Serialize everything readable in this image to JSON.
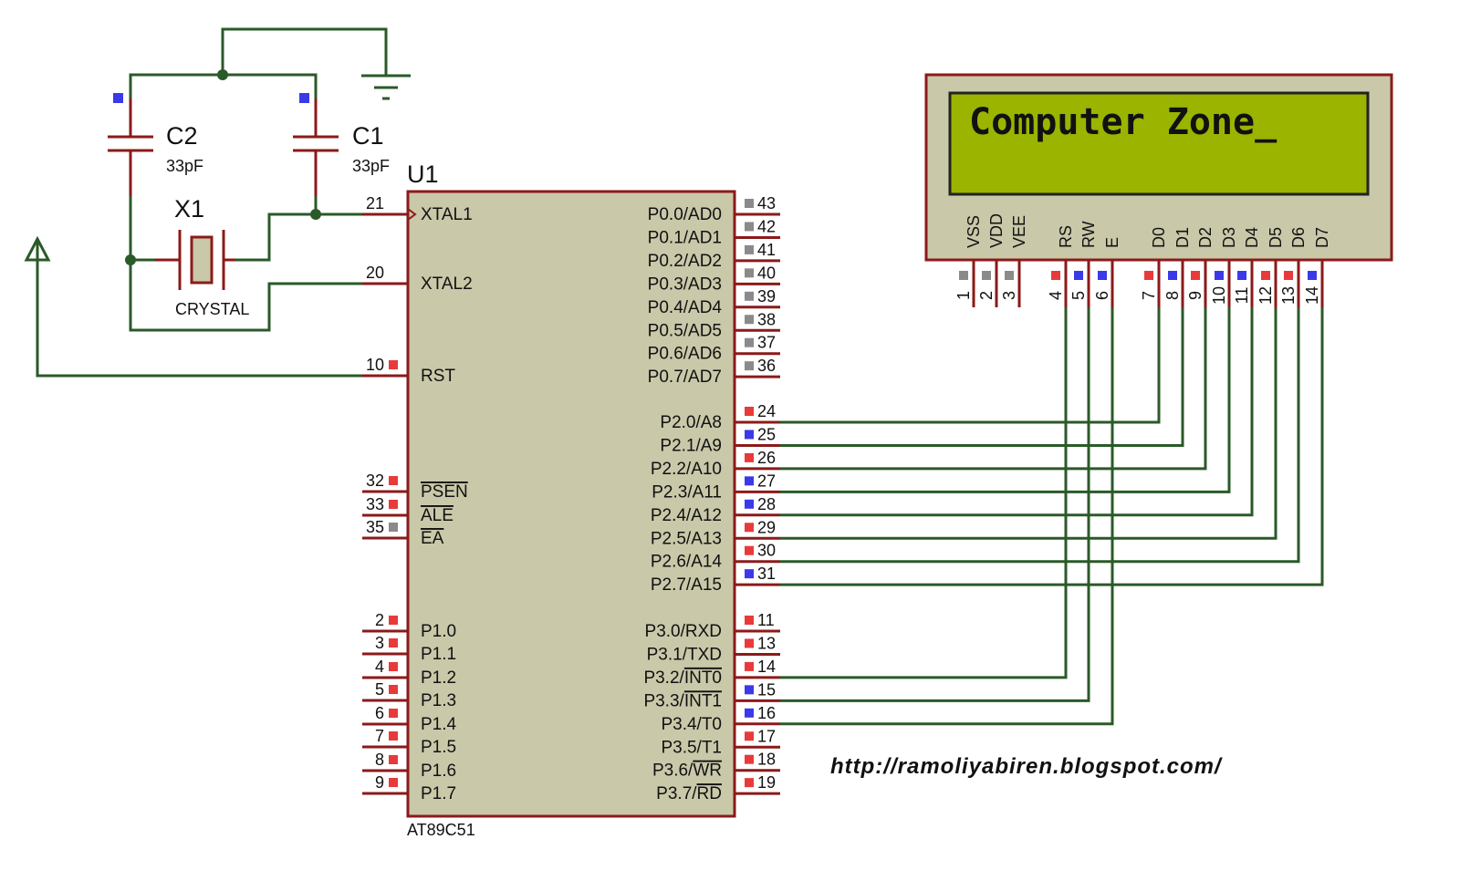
{
  "colors": {
    "wire": "#2a5a28",
    "pin": "#8b1a1a",
    "body": "#c9c8a9",
    "lcd_screen": "#9ab400",
    "high": "#e83a3a",
    "low": "#3a3ae8",
    "float": "#8a8a8a"
  },
  "crystal": {
    "c2": {
      "ref": "C2",
      "value": "33pF"
    },
    "c1": {
      "ref": "C1",
      "value": "33pF"
    },
    "x1": {
      "ref": "X1",
      "value": "CRYSTAL"
    }
  },
  "mcu": {
    "ref": "U1",
    "part": "AT89C51",
    "left_pins": [
      {
        "num": "21",
        "pre": "XTAL1",
        "ov": "",
        "state": ""
      },
      {
        "num": "20",
        "pre": "XTAL2",
        "ov": "",
        "state": ""
      },
      {
        "num": "10",
        "pre": "RST",
        "ov": "",
        "state": "high"
      },
      {
        "num": "32",
        "pre": "",
        "ov": "PSEN",
        "state": "high"
      },
      {
        "num": "33",
        "pre": "",
        "ov": "ALE",
        "state": "high"
      },
      {
        "num": "35",
        "pre": "",
        "ov": "EA",
        "state": "float"
      },
      {
        "num": "2",
        "pre": "P1.0",
        "ov": "",
        "state": "high"
      },
      {
        "num": "3",
        "pre": "P1.1",
        "ov": "",
        "state": "high"
      },
      {
        "num": "4",
        "pre": "P1.2",
        "ov": "",
        "state": "high"
      },
      {
        "num": "5",
        "pre": "P1.3",
        "ov": "",
        "state": "high"
      },
      {
        "num": "6",
        "pre": "P1.4",
        "ov": "",
        "state": "high"
      },
      {
        "num": "7",
        "pre": "P1.5",
        "ov": "",
        "state": "high"
      },
      {
        "num": "8",
        "pre": "P1.6",
        "ov": "",
        "state": "high"
      },
      {
        "num": "9",
        "pre": "P1.7",
        "ov": "",
        "state": "high"
      }
    ],
    "right_pins": [
      {
        "num": "43",
        "pre": "P0.0/AD0",
        "ov": "",
        "state": "float"
      },
      {
        "num": "42",
        "pre": "P0.1/AD1",
        "ov": "",
        "state": "float"
      },
      {
        "num": "41",
        "pre": "P0.2/AD2",
        "ov": "",
        "state": "float"
      },
      {
        "num": "40",
        "pre": "P0.3/AD3",
        "ov": "",
        "state": "float"
      },
      {
        "num": "39",
        "pre": "P0.4/AD4",
        "ov": "",
        "state": "float"
      },
      {
        "num": "38",
        "pre": "P0.5/AD5",
        "ov": "",
        "state": "float"
      },
      {
        "num": "37",
        "pre": "P0.6/AD6",
        "ov": "",
        "state": "float"
      },
      {
        "num": "36",
        "pre": "P0.7/AD7",
        "ov": "",
        "state": "float"
      },
      {
        "num": "24",
        "pre": "P2.0/A8",
        "ov": "",
        "state": "high"
      },
      {
        "num": "25",
        "pre": "P2.1/A9",
        "ov": "",
        "state": "low"
      },
      {
        "num": "26",
        "pre": "P2.2/A10",
        "ov": "",
        "state": "high"
      },
      {
        "num": "27",
        "pre": "P2.3/A11",
        "ov": "",
        "state": "low"
      },
      {
        "num": "28",
        "pre": "P2.4/A12",
        "ov": "",
        "state": "low"
      },
      {
        "num": "29",
        "pre": "P2.5/A13",
        "ov": "",
        "state": "high"
      },
      {
        "num": "30",
        "pre": "P2.6/A14",
        "ov": "",
        "state": "high"
      },
      {
        "num": "31",
        "pre": "P2.7/A15",
        "ov": "",
        "state": "low"
      },
      {
        "num": "11",
        "pre": "P3.0/RXD",
        "ov": "",
        "state": "high"
      },
      {
        "num": "13",
        "pre": "P3.1/TXD",
        "ov": "",
        "state": "high"
      },
      {
        "num": "14",
        "pre": "P3.2/",
        "ov": "INT0",
        "state": "high"
      },
      {
        "num": "15",
        "pre": "P3.3/",
        "ov": "INT1",
        "state": "low"
      },
      {
        "num": "16",
        "pre": "P3.4/T0",
        "ov": "",
        "state": "low"
      },
      {
        "num": "17",
        "pre": "P3.5/T1",
        "ov": "",
        "state": "high"
      },
      {
        "num": "18",
        "pre": "P3.6/",
        "ov": "WR",
        "state": "high"
      },
      {
        "num": "19",
        "pre": "P3.7/",
        "ov": "RD",
        "state": "high"
      }
    ]
  },
  "lcd": {
    "text": "Computer Zone_",
    "pins": [
      {
        "num": "1",
        "name": "VSS",
        "state": "float"
      },
      {
        "num": "2",
        "name": "VDD",
        "state": "float"
      },
      {
        "num": "3",
        "name": "VEE",
        "state": "float"
      },
      {
        "num": "4",
        "name": "RS",
        "state": "high"
      },
      {
        "num": "5",
        "name": "RW",
        "state": "low"
      },
      {
        "num": "6",
        "name": "E",
        "state": "low"
      },
      {
        "num": "7",
        "name": "D0",
        "state": "high"
      },
      {
        "num": "8",
        "name": "D1",
        "state": "low"
      },
      {
        "num": "9",
        "name": "D2",
        "state": "high"
      },
      {
        "num": "10",
        "name": "D3",
        "state": "low"
      },
      {
        "num": "11",
        "name": "D4",
        "state": "low"
      },
      {
        "num": "12",
        "name": "D5",
        "state": "high"
      },
      {
        "num": "13",
        "name": "D6",
        "state": "high"
      },
      {
        "num": "14",
        "name": "D7",
        "state": "low"
      }
    ]
  },
  "watermark": "http://ramoliyabiren.blogspot.com/"
}
